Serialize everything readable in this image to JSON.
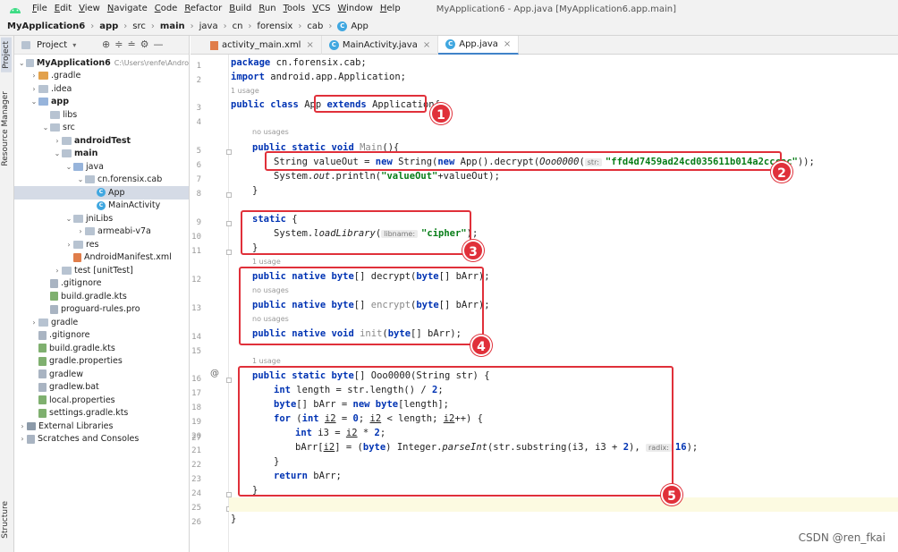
{
  "menubar": {
    "items": [
      "File",
      "Edit",
      "View",
      "Navigate",
      "Code",
      "Refactor",
      "Build",
      "Run",
      "Tools",
      "VCS",
      "Window",
      "Help"
    ],
    "window_title": "MyApplication6 - App.java [MyApplication6.app.main]"
  },
  "breadcrumb": [
    "MyApplication6",
    "app",
    "src",
    "main",
    "java",
    "cn",
    "forensix",
    "cab",
    "App"
  ],
  "left_strip": {
    "project": "Project",
    "resource_manager": "Resource Manager",
    "structure": "Structure"
  },
  "project_panel": {
    "title": "Project"
  },
  "tree": [
    {
      "label": "MyApplication6",
      "extra": "C:\\Users\\renfe\\Andro",
      "depth": 0,
      "open": true,
      "bold": true,
      "icon": "folder"
    },
    {
      "label": ".gradle",
      "depth": 1,
      "open": false,
      "icon": "folder-orange"
    },
    {
      "label": ".idea",
      "depth": 1,
      "open": false,
      "icon": "folder"
    },
    {
      "label": "app",
      "depth": 1,
      "open": true,
      "bold": true,
      "icon": "folder-special"
    },
    {
      "label": "libs",
      "depth": 2,
      "icon": "folder"
    },
    {
      "label": "src",
      "depth": 2,
      "open": true,
      "icon": "folder"
    },
    {
      "label": "androidTest",
      "depth": 3,
      "open": false,
      "bold": true,
      "icon": "folder"
    },
    {
      "label": "main",
      "depth": 3,
      "open": true,
      "bold": true,
      "icon": "folder"
    },
    {
      "label": "java",
      "depth": 4,
      "open": true,
      "icon": "folder-special"
    },
    {
      "label": "cn.forensix.cab",
      "depth": 5,
      "open": true,
      "icon": "folder"
    },
    {
      "label": "App",
      "depth": 6,
      "icon": "java",
      "selected": true
    },
    {
      "label": "MainActivity",
      "depth": 6,
      "icon": "java"
    },
    {
      "label": "jniLibs",
      "depth": 4,
      "open": true,
      "icon": "folder"
    },
    {
      "label": "armeabi-v7a",
      "depth": 5,
      "open": false,
      "icon": "folder"
    },
    {
      "label": "res",
      "depth": 4,
      "open": false,
      "icon": "folder"
    },
    {
      "label": "AndroidManifest.xml",
      "depth": 4,
      "icon": "xml"
    },
    {
      "label": "test [unitTest]",
      "depth": 3,
      "open": false,
      "icon": "folder"
    },
    {
      "label": ".gitignore",
      "depth": 2,
      "icon": "text"
    },
    {
      "label": "build.gradle.kts",
      "depth": 2,
      "icon": "gradle"
    },
    {
      "label": "proguard-rules.pro",
      "depth": 2,
      "icon": "text"
    },
    {
      "label": "gradle",
      "depth": 1,
      "open": false,
      "icon": "folder"
    },
    {
      "label": ".gitignore",
      "depth": 1,
      "icon": "text"
    },
    {
      "label": "build.gradle.kts",
      "depth": 1,
      "icon": "gradle"
    },
    {
      "label": "gradle.properties",
      "depth": 1,
      "icon": "gradle"
    },
    {
      "label": "gradlew",
      "depth": 1,
      "icon": "text"
    },
    {
      "label": "gradlew.bat",
      "depth": 1,
      "icon": "text"
    },
    {
      "label": "local.properties",
      "depth": 1,
      "icon": "gradle"
    },
    {
      "label": "settings.gradle.kts",
      "depth": 1,
      "icon": "gradle"
    },
    {
      "label": "External Libraries",
      "depth": 0,
      "open": false,
      "icon": "lib"
    },
    {
      "label": "Scratches and Consoles",
      "depth": 0,
      "open": false,
      "icon": "scratch"
    }
  ],
  "tabs": [
    {
      "label": "activity_main.xml",
      "icon": "xml"
    },
    {
      "label": "MainActivity.java",
      "icon": "java"
    },
    {
      "label": "App.java",
      "icon": "java",
      "active": true
    }
  ],
  "editor": {
    "line_numbers": [
      "1",
      "2",
      "",
      "3",
      "4",
      "",
      "5",
      "6",
      "7",
      "8",
      "9",
      "10",
      "11",
      "12",
      "",
      "13",
      "",
      "14",
      "",
      "15",
      "16",
      "",
      "17",
      "18",
      "19",
      "20",
      "21",
      "22",
      "23",
      "24",
      "25",
      "26",
      "27"
    ],
    "hints": {
      "usage1": "1 usage",
      "no_usages": "no usages",
      "str_param": "str:",
      "libname_param": "libname:",
      "radix_param": "radix:"
    },
    "lines": {
      "l1": [
        "package ",
        "cn.forensix.cab;"
      ],
      "l2": [
        "import ",
        "android.app.Application;"
      ],
      "l3": [
        "public class ",
        "App ",
        "extends ",
        "Application{"
      ],
      "l5": [
        "public static void ",
        "Main",
        "(){"
      ],
      "l6": [
        "String valueOut = ",
        "new ",
        "String(",
        "new ",
        "App().decrypt(",
        "Ooo0000",
        "(",
        "\"ffd4d7459ad24cd035611b014a2cccac\"",
        "));"
      ],
      "l7": [
        "System.",
        "out",
        ".println(",
        "\"valueOut\"",
        "+valueOut);"
      ],
      "l8": "}",
      "l10": [
        "static ",
        "{"
      ],
      "l11": [
        "System.",
        "loadLibrary",
        "(",
        "\"cipher\"",
        ");"
      ],
      "l12": "}",
      "l13": [
        "public native byte",
        "[] decrypt(",
        "byte",
        "[] bArr);"
      ],
      "l14": [
        "public native byte",
        "[] ",
        "encrypt",
        "(",
        "byte",
        "[] bArr);"
      ],
      "l15": [
        "public native void ",
        "init",
        "(",
        "byte",
        "[] bArr);"
      ],
      "l17": [
        "public static byte",
        "[] Ooo0000(String str) {"
      ],
      "l18": [
        "int ",
        "length = str.length() / ",
        "2",
        ";"
      ],
      "l19": [
        "byte",
        "[] bArr = ",
        "new byte",
        "[length];"
      ],
      "l20": [
        "for ",
        "(",
        "int ",
        "i2",
        " = ",
        "0",
        "; ",
        "i2",
        " < length; ",
        "i2",
        "++) {"
      ],
      "l21": [
        "int ",
        "i3 = ",
        "i2",
        " * ",
        "2",
        ";"
      ],
      "l22": [
        "bArr[",
        "i2",
        "] = (",
        "byte",
        ") Integer.",
        "parseInt",
        "(str.substring(i3, i3 + ",
        "2",
        "), ",
        "16",
        ");"
      ],
      "l23": "}",
      "l24": [
        "return ",
        "bArr;"
      ],
      "l25": "}",
      "l27": "}"
    }
  },
  "annotations": [
    "1",
    "2",
    "3",
    "4",
    "5"
  ],
  "watermark": "CSDN @ren_fkai"
}
